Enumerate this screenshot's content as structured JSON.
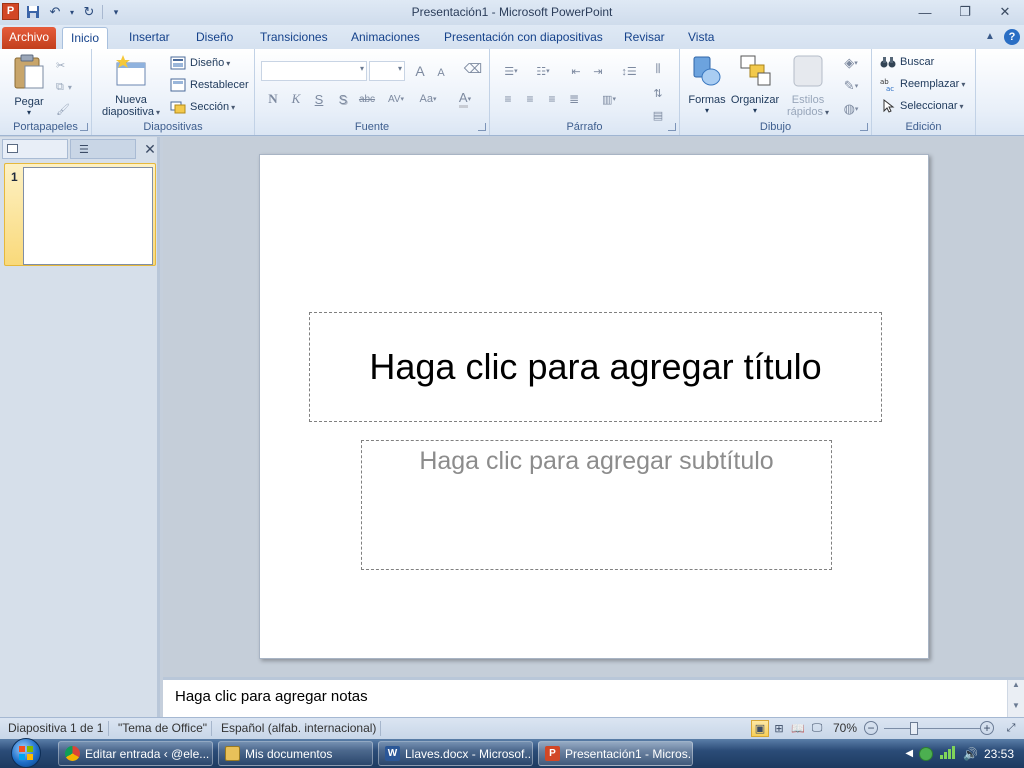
{
  "window": {
    "title": "Presentación1  -  Microsoft PowerPoint",
    "app_icon_letter": "P"
  },
  "ribbon_tabs": {
    "file": "Archivo",
    "items": [
      "Inicio",
      "Insertar",
      "Diseño",
      "Transiciones",
      "Animaciones",
      "Presentación con diapositivas",
      "Revisar",
      "Vista"
    ],
    "active": "Inicio"
  },
  "ribbon": {
    "clipboard": {
      "label": "Portapapeles",
      "paste": "Pegar"
    },
    "slides": {
      "label": "Diapositivas",
      "new_slide_line1": "Nueva",
      "new_slide_line2": "diapositiva",
      "layout": "Diseño",
      "reset": "Restablecer",
      "section": "Sección"
    },
    "font": {
      "label": "Fuente",
      "bold": "N",
      "italic": "K",
      "underline": "S",
      "shadow": "S",
      "strike": "abc",
      "spacing": "AV",
      "case": "Aa",
      "grow": "A",
      "shrink": "A",
      "color": "A"
    },
    "paragraph": {
      "label": "Párrafo"
    },
    "drawing": {
      "label": "Dibujo",
      "shapes": "Formas",
      "arrange": "Organizar",
      "quick_styles_line1": "Estilos",
      "quick_styles_line2": "rápidos"
    },
    "editing": {
      "label": "Edición",
      "find": "Buscar",
      "replace": "Reemplazar",
      "select": "Seleccionar"
    }
  },
  "slides_panel": {
    "thumbnails": [
      {
        "number": "1"
      }
    ]
  },
  "slide": {
    "title_placeholder": "Haga clic para agregar título",
    "subtitle_placeholder": "Haga clic para agregar subtítulo"
  },
  "notes": {
    "placeholder": "Haga clic para agregar notas"
  },
  "status": {
    "slide_count": "Diapositiva 1 de 1",
    "theme": "\"Tema de Office\"",
    "language": "Español (alfab. internacional)",
    "zoom": "70%"
  },
  "taskbar": {
    "items": [
      {
        "label": "Editar entrada ‹ @ele...",
        "icon": "chrome-icon"
      },
      {
        "label": "Mis documentos",
        "icon": "folder-icon"
      },
      {
        "label": "Llaves.docx - Microsof...",
        "icon": "word-icon"
      },
      {
        "label": "Presentación1 - Micros...",
        "icon": "powerpoint-icon"
      }
    ],
    "clock": "23:53"
  },
  "colors": {
    "file_tab": "#d24726",
    "ribbon_text": "#15428b",
    "selected_thumb": "#f9d97a"
  }
}
